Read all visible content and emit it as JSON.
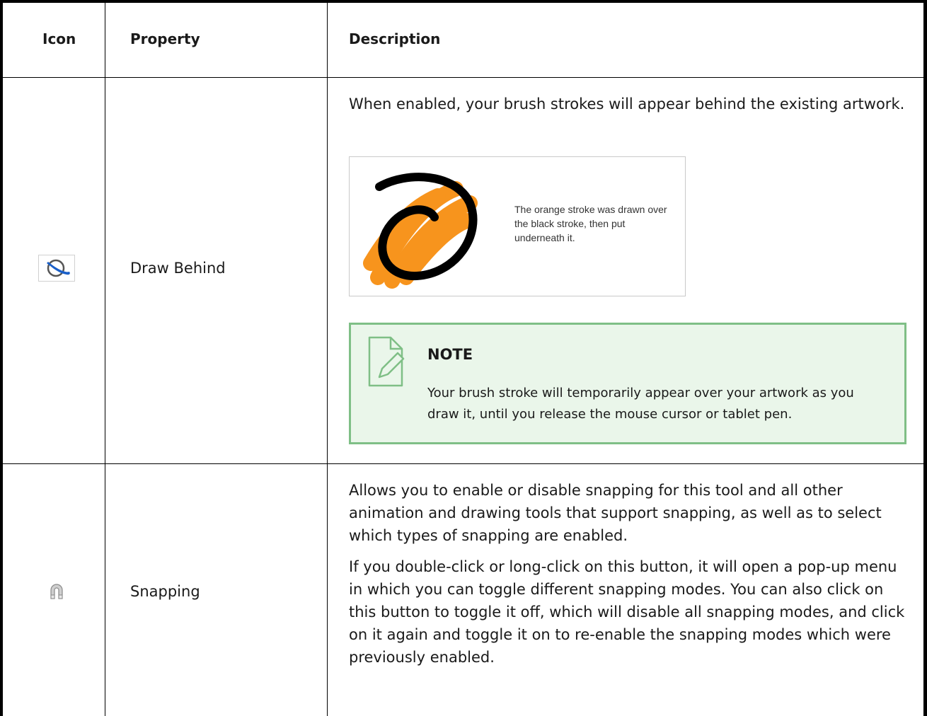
{
  "header": {
    "icon": "Icon",
    "property": "Property",
    "description": "Description"
  },
  "rows": [
    {
      "icon": "draw-behind-icon",
      "property": "Draw Behind",
      "description": "When enabled, your brush strokes will appear behind the existing artwork.",
      "figure": {
        "caption": "The orange stroke was drawn over the black stroke, then put underneath it."
      },
      "note": {
        "title": "NOTE",
        "body": "Your brush stroke will temporarily appear over your artwork as you draw it, until you release the mouse cursor or tablet pen."
      }
    },
    {
      "icon": "magnet-icon",
      "property": "Snapping",
      "description": [
        "Allows you to enable or disable snapping for this tool and all other animation and drawing tools that support snapping, as well as to select which types of snapping are enabled.",
        "If you double-click or long-click on this button, it will open a pop-up menu in which you can toggle different snapping modes. You can also click on this button to toggle it off, which will disable all snapping modes, and click on it again and toggle it on to re-enable the snapping modes which were previously enabled."
      ]
    }
  ],
  "colors": {
    "note_background": "#eaf6ea",
    "note_border": "#7fbf86",
    "orange_stroke": "#f7941d",
    "black_stroke": "#000000"
  }
}
